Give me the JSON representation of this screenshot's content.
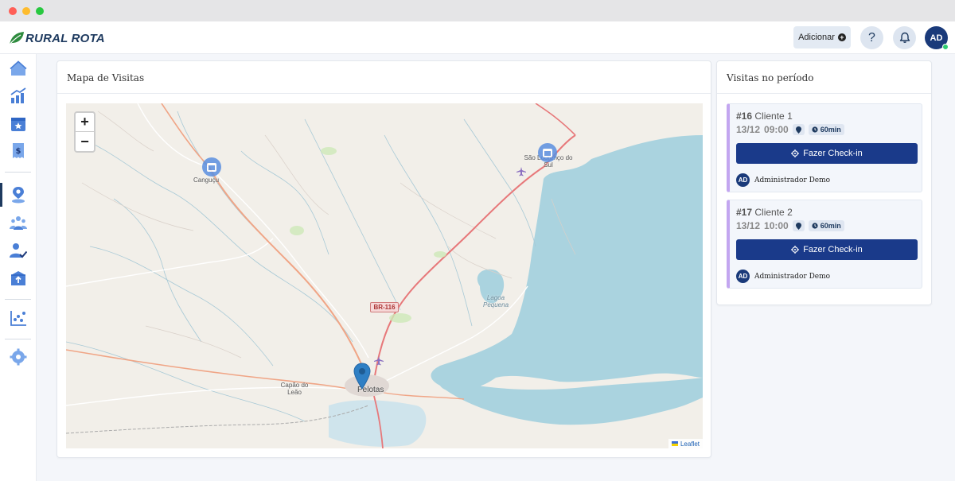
{
  "window": {
    "controls": [
      "close",
      "minimize",
      "maximize"
    ]
  },
  "header": {
    "brand": "RURAL ROTA",
    "add_label": "Adicionar",
    "help_label": "?",
    "avatar_initials": "AD"
  },
  "sidebar": {
    "items": [
      {
        "icon": "home-icon"
      },
      {
        "icon": "chart-up-icon"
      },
      {
        "icon": "calendar-star-icon"
      },
      {
        "icon": "receipt-dollar-icon"
      },
      {
        "icon": "map-user-icon",
        "active": true
      },
      {
        "icon": "users-icon"
      },
      {
        "icon": "user-check-icon"
      },
      {
        "icon": "box-upload-icon"
      },
      {
        "icon": "scatter-chart-icon"
      },
      {
        "icon": "gear-icon"
      }
    ]
  },
  "map_panel": {
    "title": "Mapa de Visitas",
    "zoom_in": "+",
    "zoom_out": "−",
    "labels": {
      "cangucu": "Canguçu",
      "sao_lourenco": "São Lourenço do Sul",
      "lagoa": "Lagoa Pequena",
      "capao": "Capão do Leão",
      "pelotas": "Pelotas"
    },
    "route": "BR-116",
    "attribution": "Leaflet"
  },
  "visits_panel": {
    "title": "Visitas no período",
    "visits": [
      {
        "number": "#16",
        "client": "Cliente 1",
        "date": "13/12",
        "time": "09:00",
        "duration": "60min",
        "checkin_label": "Fazer Check-in",
        "user_initials": "AD",
        "user_name": "Administrador Demo"
      },
      {
        "number": "#17",
        "client": "Cliente 2",
        "date": "13/12",
        "time": "10:00",
        "duration": "60min",
        "checkin_label": "Fazer Check-in",
        "user_initials": "AD",
        "user_name": "Administrador Demo"
      }
    ]
  },
  "colors": {
    "brand": "#1e3a5f",
    "primary_button": "#1a3a8a",
    "visit_accent": "#c3a6f0",
    "sidebar_icon": "#6a9be8",
    "water": "#aad3df",
    "online": "#2ecc71"
  }
}
